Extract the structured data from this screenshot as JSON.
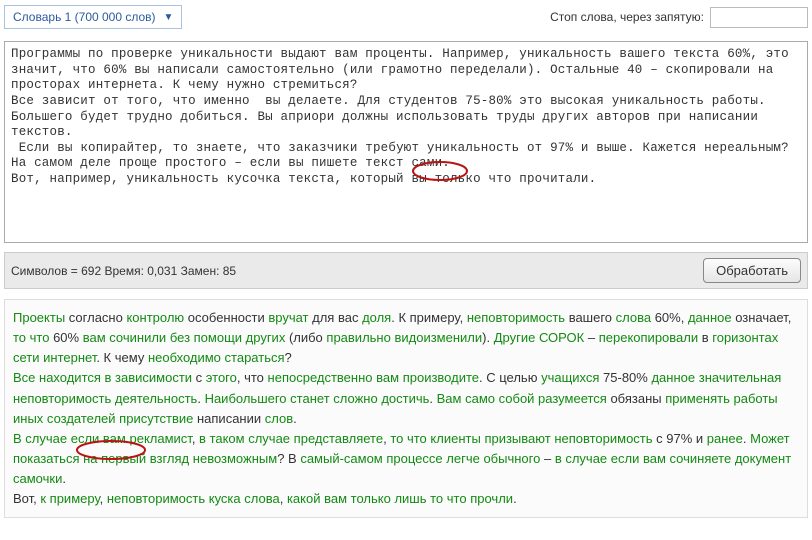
{
  "dict_select": {
    "label": "Словарь 1 (700 000 слов)"
  },
  "stop_words": {
    "label": "Стоп слова, через запятую:",
    "value": ""
  },
  "input_text": "Программы по проверке уникальности выдают вам проценты. Например, уникальность вашего текста 60%, это значит, что 60% вы написали самостоятельно (или грамотно переделали). Остальные 40 – скопировали на просторах интернета. К чему нужно стремиться?\nВсе зависит от того, что именно  вы делаете. Для студентов 75-80% это высокая уникальность работы. Большего будет трудно добиться. Вы априори должны использовать труды других авторов при написании текстов.\n Если вы копирайтер, то знаете, что заказчики требуют уникальность от 97% и выше. Кажется нереальным? На самом деле проще простого – если вы пишете текст сами.\nВот, например, уникальность кусочка текста, который вы только что прочитали.",
  "stats": {
    "text": "Символов = 692  Время: 0,031  Замен: 85"
  },
  "process_button": {
    "label": "Обработать"
  },
  "output": {
    "p1": [
      {
        "t": "Проекты",
        "g": true
      },
      {
        "t": " согласно ",
        "g": false
      },
      {
        "t": "контролю",
        "g": true
      },
      {
        "t": " особенности ",
        "g": false
      },
      {
        "t": "вручат",
        "g": true
      },
      {
        "t": " для вас ",
        "g": false
      },
      {
        "t": "доля",
        "g": true
      },
      {
        "t": ". К примеру, ",
        "g": false
      },
      {
        "t": "неповторимость",
        "g": true
      },
      {
        "t": " вашего ",
        "g": false
      },
      {
        "t": "слова",
        "g": true
      },
      {
        "t": " 60%, ",
        "g": false
      },
      {
        "t": "данное",
        "g": true
      },
      {
        "t": " означает, ",
        "g": false
      },
      {
        "t": "то что",
        "g": true
      },
      {
        "t": " 60% ",
        "g": false
      },
      {
        "t": "вам",
        "g": true
      },
      {
        "t": " ",
        "g": false
      },
      {
        "t": "сочинили",
        "g": true
      },
      {
        "t": " ",
        "g": false
      },
      {
        "t": "без помощи других",
        "g": true
      },
      {
        "t": " (либо ",
        "g": false
      },
      {
        "t": "правильно",
        "g": true
      },
      {
        "t": " ",
        "g": false
      },
      {
        "t": "видоизменили",
        "g": true
      },
      {
        "t": "). ",
        "g": false
      },
      {
        "t": "Другие",
        "g": true
      },
      {
        "t": " ",
        "g": false
      },
      {
        "t": "СОРОК",
        "g": true
      },
      {
        "t": " – ",
        "g": false
      },
      {
        "t": "перекопировали",
        "g": true
      },
      {
        "t": " в ",
        "g": false
      },
      {
        "t": "горизонтах",
        "g": true
      },
      {
        "t": " ",
        "g": false
      },
      {
        "t": "сети интернет",
        "g": true
      },
      {
        "t": ". К чему ",
        "g": false
      },
      {
        "t": "необходимо",
        "g": true
      },
      {
        "t": " ",
        "g": false
      },
      {
        "t": "стараться",
        "g": true
      },
      {
        "t": "?",
        "g": false
      }
    ],
    "p2": [
      {
        "t": "Все находится в зависимости",
        "g": true
      },
      {
        "t": " с ",
        "g": false
      },
      {
        "t": "этого",
        "g": true
      },
      {
        "t": ", что ",
        "g": false
      },
      {
        "t": "непосредственно",
        "g": true
      },
      {
        "t": " ",
        "g": false
      },
      {
        "t": "вам",
        "g": true
      },
      {
        "t": " ",
        "g": false
      },
      {
        "t": "производите",
        "g": true
      },
      {
        "t": ". С целью ",
        "g": false
      },
      {
        "t": "учащихся",
        "g": true
      },
      {
        "t": " 75-80% ",
        "g": false
      },
      {
        "t": "данное",
        "g": true
      },
      {
        "t": " ",
        "g": false
      },
      {
        "t": "значительная",
        "g": true
      },
      {
        "t": " ",
        "g": false
      },
      {
        "t": "неповторимость",
        "g": true
      },
      {
        "t": " ",
        "g": false
      },
      {
        "t": "деятельность",
        "g": true
      },
      {
        "t": ". ",
        "g": false
      },
      {
        "t": "Наибольшего",
        "g": true
      },
      {
        "t": " ",
        "g": false
      },
      {
        "t": "станет",
        "g": true
      },
      {
        "t": " ",
        "g": false
      },
      {
        "t": "сложно",
        "g": true
      },
      {
        "t": " ",
        "g": false
      },
      {
        "t": "достичь",
        "g": true
      },
      {
        "t": ". ",
        "g": false
      },
      {
        "t": "Вам",
        "g": true
      },
      {
        "t": " ",
        "g": false
      },
      {
        "t": "само собой разумеется",
        "g": true
      },
      {
        "t": " обязаны ",
        "g": false
      },
      {
        "t": "применять",
        "g": true
      },
      {
        "t": " ",
        "g": false
      },
      {
        "t": "работы",
        "g": true
      },
      {
        "t": " ",
        "g": false
      },
      {
        "t": "иных",
        "g": true
      },
      {
        "t": " ",
        "g": false
      },
      {
        "t": "создателей",
        "g": true
      },
      {
        "t": " ",
        "g": false
      },
      {
        "t": "присутствие",
        "g": true
      },
      {
        "t": " написании ",
        "g": false
      },
      {
        "t": "слов",
        "g": true
      },
      {
        "t": ".",
        "g": false
      }
    ],
    "p3": [
      {
        "t": "В случае если",
        "g": true
      },
      {
        "t": " ",
        "g": false
      },
      {
        "t": "вам",
        "g": true
      },
      {
        "t": " ",
        "g": false
      },
      {
        "t": "рекламист",
        "g": true
      },
      {
        "t": ", ",
        "g": false
      },
      {
        "t": "в таком случае",
        "g": true
      },
      {
        "t": " ",
        "g": false
      },
      {
        "t": "представляете",
        "g": true
      },
      {
        "t": ", ",
        "g": false
      },
      {
        "t": "то что",
        "g": true
      },
      {
        "t": " ",
        "g": false
      },
      {
        "t": "клиенты",
        "g": true
      },
      {
        "t": " ",
        "g": false
      },
      {
        "t": "призывают",
        "g": true
      },
      {
        "t": " ",
        "g": false
      },
      {
        "t": "неповторимость",
        "g": true
      },
      {
        "t": " с 97% и ",
        "g": false
      },
      {
        "t": "ранее",
        "g": true
      },
      {
        "t": ". ",
        "g": false
      },
      {
        "t": "Может показаться на первый взгляд",
        "g": true
      },
      {
        "t": " ",
        "g": false
      },
      {
        "t": "невозможным",
        "g": true
      },
      {
        "t": "? В ",
        "g": false
      },
      {
        "t": "самый-самом",
        "g": true
      },
      {
        "t": " ",
        "g": false
      },
      {
        "t": "процессе",
        "g": true
      },
      {
        "t": " ",
        "g": false
      },
      {
        "t": "легче",
        "g": true
      },
      {
        "t": " ",
        "g": false
      },
      {
        "t": "обычного",
        "g": true
      },
      {
        "t": " – ",
        "g": false
      },
      {
        "t": "в случае если",
        "g": true
      },
      {
        "t": " ",
        "g": false
      },
      {
        "t": "вам",
        "g": true
      },
      {
        "t": " ",
        "g": false
      },
      {
        "t": "сочиняете",
        "g": true
      },
      {
        "t": " ",
        "g": false
      },
      {
        "t": "документ",
        "g": true
      },
      {
        "t": " ",
        "g": false
      },
      {
        "t": "самочки",
        "g": true
      },
      {
        "t": ".",
        "g": false
      }
    ],
    "p4": [
      {
        "t": "Вот, ",
        "g": false
      },
      {
        "t": "к примеру",
        "g": true
      },
      {
        "t": ", ",
        "g": false
      },
      {
        "t": "неповторимость",
        "g": true
      },
      {
        "t": " ",
        "g": false
      },
      {
        "t": "куска",
        "g": true
      },
      {
        "t": " ",
        "g": false
      },
      {
        "t": "слова",
        "g": true
      },
      {
        "t": ", ",
        "g": false
      },
      {
        "t": "какой",
        "g": true
      },
      {
        "t": " ",
        "g": false
      },
      {
        "t": "вам",
        "g": true
      },
      {
        "t": " ",
        "g": false
      },
      {
        "t": "только лишь",
        "g": true
      },
      {
        "t": " ",
        "g": false
      },
      {
        "t": "то что",
        "g": true
      },
      {
        "t": " ",
        "g": false
      },
      {
        "t": "прочли",
        "g": true
      },
      {
        "t": ".",
        "g": false
      }
    ]
  }
}
